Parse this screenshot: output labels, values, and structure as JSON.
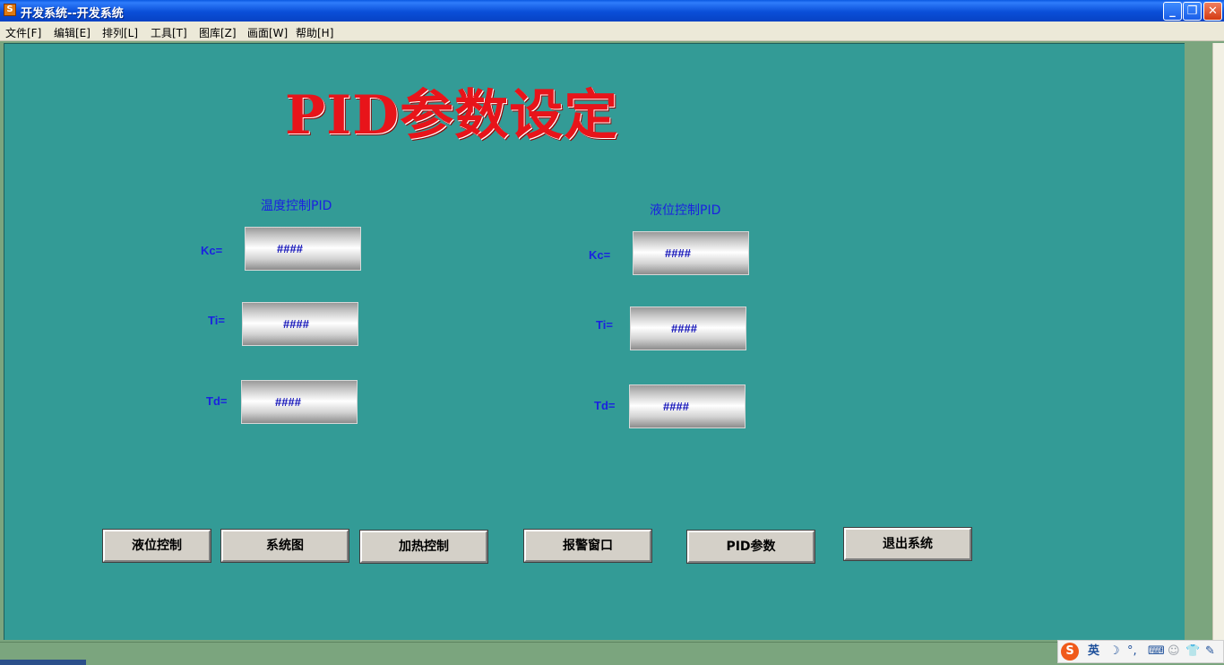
{
  "window": {
    "title": "开发系统--开发系统",
    "app_icon_glyph": "S",
    "minimize": "_",
    "maximize": "❐",
    "close": "✕"
  },
  "menu": [
    "文件[F]",
    "编辑[E]",
    "排列[L]",
    "工具[T]",
    "图库[Z]",
    "画面[W]",
    "帮助[H]"
  ],
  "page": {
    "title": "PID参数设定"
  },
  "groups": [
    {
      "title": "温度控制PID",
      "params": [
        {
          "label": "Kc=",
          "value": "####"
        },
        {
          "label": "Ti=",
          "value": "####"
        },
        {
          "label": "Td=",
          "value": "####"
        }
      ]
    },
    {
      "title": "液位控制PID",
      "params": [
        {
          "label": "Kc=",
          "value": "####"
        },
        {
          "label": "Ti=",
          "value": "####"
        },
        {
          "label": "Td=",
          "value": "####"
        }
      ]
    }
  ],
  "nav_buttons": [
    "液位控制",
    "系统图",
    "加热控制",
    "报警窗口",
    "PID参数",
    "退出系统"
  ],
  "ime": {
    "logo": "S",
    "mode": "英",
    "moon": "☽",
    "punct": "°,",
    "keyboard": "⌨",
    "user": "☺",
    "shirt": "👕",
    "tool": "✎"
  },
  "colors": {
    "canvas": "#339b96",
    "title_red": "#e8141a",
    "label_blue": "#1a22e0"
  }
}
